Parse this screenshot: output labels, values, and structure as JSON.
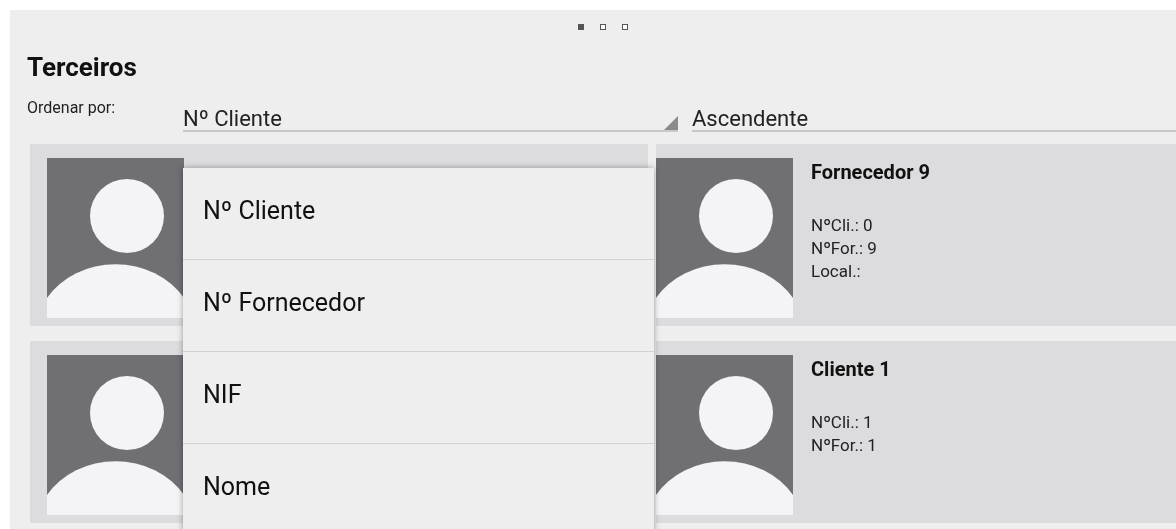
{
  "pager": [
    {
      "selected": true
    },
    {
      "selected": false
    },
    {
      "selected": false
    }
  ],
  "title": "Terceiros",
  "sort": {
    "label": "Ordenar por:",
    "field": "Nº Cliente",
    "order": "Ascendente"
  },
  "cards": [
    {
      "name": "Fornecedor 9",
      "fields": [
        "NºCli.: 0",
        "NºFor.: 9",
        "Local.:"
      ]
    },
    {
      "name": "Cliente 1",
      "fields": [
        "NºCli.: 1",
        "NºFor.: 1"
      ]
    }
  ],
  "dropdown": {
    "options": [
      "Nº Cliente",
      "Nº Fornecedor",
      "NIF",
      "Nome"
    ]
  }
}
